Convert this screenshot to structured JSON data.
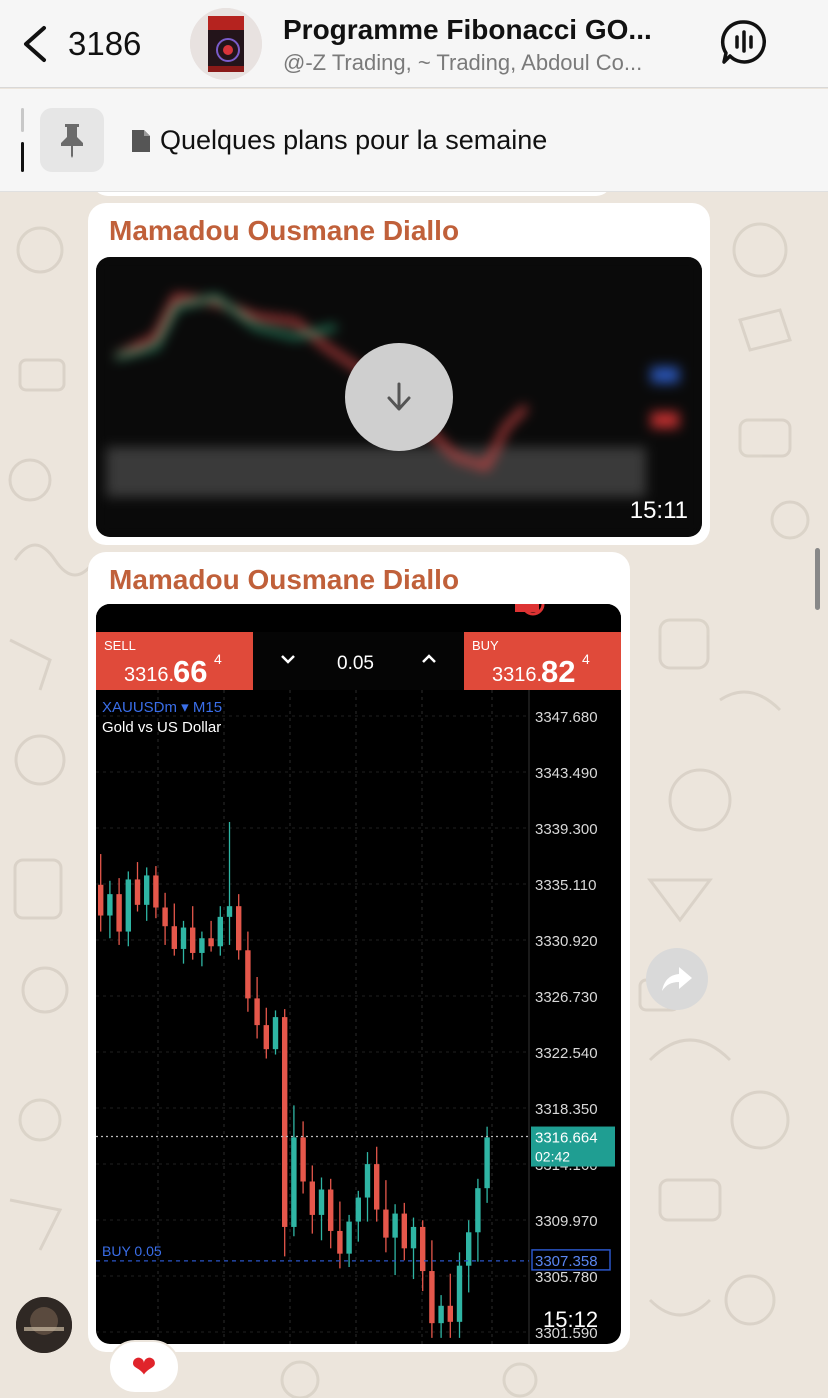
{
  "header": {
    "back_count": "3186",
    "title": "Programme Fibonacci GO...",
    "subtitle": "@-Z Trading, ~ Trading, Abdoul Co...",
    "avatar_label": "FIBONACCI"
  },
  "pinned": {
    "text": "Quelques plans pour la semaine"
  },
  "messages": [
    {
      "sender": "Mamadou Ousmane Diallo",
      "time": "15:11",
      "media": "blurred-video"
    },
    {
      "sender": "Mamadou Ousmane Diallo",
      "time": "15:12",
      "media": "chart-screenshot",
      "reaction": "❤"
    }
  ],
  "trade_panel": {
    "sell_label": "SELL",
    "sell_price_main": "3316.",
    "sell_price_big": "66",
    "sell_price_sup": "4",
    "lot": "0.05",
    "buy_label": "BUY",
    "buy_price_main": "3316.",
    "buy_price_big": "82",
    "buy_price_sup": "4",
    "symbol": "XAUUSDm ▾ M15",
    "description": "Gold vs US Dollar",
    "current_price": "3316.664",
    "countdown": "02:42",
    "order_label": "BUY 0.05",
    "order_price": "3307.358",
    "price_axis": [
      "3347.680",
      "3343.490",
      "3339.300",
      "3335.110",
      "3330.920",
      "3326.730",
      "3322.540",
      "3318.350",
      "3314.160",
      "3309.970",
      "3305.780",
      "3301.590"
    ]
  },
  "chart_data": {
    "type": "candlestick",
    "title": "XAUUSDm M15",
    "ylim": [
      3301.59,
      3349.5
    ],
    "candles": [
      {
        "o": 3335.5,
        "h": 3337.8,
        "l": 3332.0,
        "c": 3333.2
      },
      {
        "o": 3333.2,
        "h": 3335.8,
        "l": 3331.5,
        "c": 3334.8
      },
      {
        "o": 3334.8,
        "h": 3336.0,
        "l": 3331.0,
        "c": 3332.0
      },
      {
        "o": 3332.0,
        "h": 3336.5,
        "l": 3330.9,
        "c": 3335.9
      },
      {
        "o": 3335.9,
        "h": 3337.2,
        "l": 3333.5,
        "c": 3334.0
      },
      {
        "o": 3334.0,
        "h": 3336.8,
        "l": 3332.8,
        "c": 3336.2
      },
      {
        "o": 3336.2,
        "h": 3336.9,
        "l": 3333.0,
        "c": 3333.8
      },
      {
        "o": 3333.8,
        "h": 3334.9,
        "l": 3331.0,
        "c": 3332.4
      },
      {
        "o": 3332.4,
        "h": 3334.1,
        "l": 3330.2,
        "c": 3330.7
      },
      {
        "o": 3330.7,
        "h": 3332.8,
        "l": 3329.6,
        "c": 3332.3
      },
      {
        "o": 3332.3,
        "h": 3333.9,
        "l": 3329.9,
        "c": 3330.4
      },
      {
        "o": 3330.4,
        "h": 3332.0,
        "l": 3329.4,
        "c": 3331.5
      },
      {
        "o": 3331.5,
        "h": 3332.8,
        "l": 3330.5,
        "c": 3330.9
      },
      {
        "o": 3330.9,
        "h": 3333.9,
        "l": 3330.2,
        "c": 3333.1
      },
      {
        "o": 3333.1,
        "h": 3340.2,
        "l": 3331.0,
        "c": 3333.9
      },
      {
        "o": 3333.9,
        "h": 3334.8,
        "l": 3329.9,
        "c": 3330.6
      },
      {
        "o": 3330.6,
        "h": 3332.0,
        "l": 3326.0,
        "c": 3327.0
      },
      {
        "o": 3327.0,
        "h": 3328.6,
        "l": 3324.0,
        "c": 3325.0
      },
      {
        "o": 3325.0,
        "h": 3326.3,
        "l": 3322.5,
        "c": 3323.2
      },
      {
        "o": 3323.2,
        "h": 3326.1,
        "l": 3322.8,
        "c": 3325.6
      },
      {
        "o": 3325.6,
        "h": 3326.2,
        "l": 3307.7,
        "c": 3309.9
      },
      {
        "o": 3309.9,
        "h": 3319.0,
        "l": 3309.2,
        "c": 3316.6
      },
      {
        "o": 3316.6,
        "h": 3317.8,
        "l": 3312.4,
        "c": 3313.3
      },
      {
        "o": 3313.3,
        "h": 3314.5,
        "l": 3309.4,
        "c": 3310.8
      },
      {
        "o": 3310.8,
        "h": 3313.6,
        "l": 3308.9,
        "c": 3312.7
      },
      {
        "o": 3312.7,
        "h": 3313.5,
        "l": 3308.3,
        "c": 3309.6
      },
      {
        "o": 3309.6,
        "h": 3311.8,
        "l": 3306.8,
        "c": 3307.9
      },
      {
        "o": 3307.9,
        "h": 3310.8,
        "l": 3306.9,
        "c": 3310.3
      },
      {
        "o": 3310.3,
        "h": 3312.6,
        "l": 3308.8,
        "c": 3312.1
      },
      {
        "o": 3312.1,
        "h": 3315.5,
        "l": 3310.3,
        "c": 3314.6
      },
      {
        "o": 3314.6,
        "h": 3315.9,
        "l": 3310.3,
        "c": 3311.2
      },
      {
        "o": 3311.2,
        "h": 3313.4,
        "l": 3308.0,
        "c": 3309.1
      },
      {
        "o": 3309.1,
        "h": 3311.6,
        "l": 3306.3,
        "c": 3310.9
      },
      {
        "o": 3310.9,
        "h": 3311.7,
        "l": 3307.4,
        "c": 3308.3
      },
      {
        "o": 3308.3,
        "h": 3310.6,
        "l": 3306.0,
        "c": 3309.9
      },
      {
        "o": 3309.9,
        "h": 3310.4,
        "l": 3305.1,
        "c": 3306.6
      },
      {
        "o": 3306.6,
        "h": 3308.9,
        "l": 3301.6,
        "c": 3302.7
      },
      {
        "o": 3302.7,
        "h": 3304.8,
        "l": 3301.6,
        "c": 3304.0
      },
      {
        "o": 3304.0,
        "h": 3306.4,
        "l": 3301.6,
        "c": 3302.8
      },
      {
        "o": 3302.8,
        "h": 3308.0,
        "l": 3301.6,
        "c": 3307.0
      },
      {
        "o": 3307.0,
        "h": 3310.4,
        "l": 3305.0,
        "c": 3309.5
      },
      {
        "o": 3309.5,
        "h": 3313.5,
        "l": 3307.3,
        "c": 3312.8
      },
      {
        "o": 3312.8,
        "h": 3317.4,
        "l": 3311.7,
        "c": 3316.6
      }
    ]
  }
}
